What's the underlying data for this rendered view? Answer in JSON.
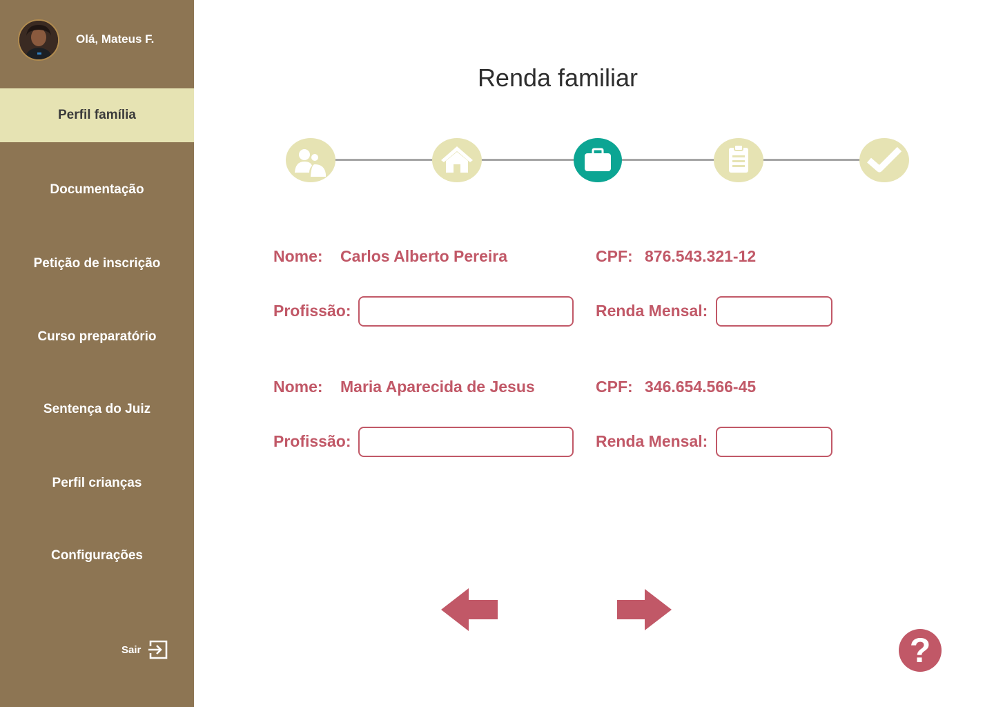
{
  "user": {
    "greeting": "Olá, Mateus F."
  },
  "sidebar": {
    "items": [
      {
        "label": "Perfil família"
      },
      {
        "label": "Documentação"
      },
      {
        "label": "Petição de inscrição"
      },
      {
        "label": "Curso preparatório"
      },
      {
        "label": "Sentença do Juiz"
      },
      {
        "label": "Perfil crianças"
      },
      {
        "label": "Configurações"
      }
    ],
    "active_item": "Perfil família",
    "logout_label": "Sair"
  },
  "page": {
    "title": "Renda familiar"
  },
  "stepper": {
    "steps": [
      {
        "icon": "family-icon",
        "state": "done"
      },
      {
        "icon": "home-icon",
        "state": "done"
      },
      {
        "icon": "briefcase-icon",
        "state": "active"
      },
      {
        "icon": "clipboard-icon",
        "state": "pending"
      },
      {
        "icon": "check-icon",
        "state": "pending"
      }
    ]
  },
  "labels": {
    "nome": "Nome:",
    "cpf": "CPF:",
    "profissao": "Profissão:",
    "renda": "Renda Mensal:"
  },
  "members": [
    {
      "nome": "Carlos Alberto Pereira",
      "cpf": "876.543.321-12",
      "profissao": "",
      "renda": ""
    },
    {
      "nome": "Maria Aparecida de Jesus",
      "cpf": "346.654.566-45",
      "profissao": "",
      "renda": ""
    }
  ],
  "help": {
    "symbol": "?"
  },
  "colors": {
    "sidebar": "#8d7553",
    "sidebar_active": "#e6e3b3",
    "accent": "#c15867",
    "step_active": "#0ca593",
    "step_inactive": "#e6e3b3"
  }
}
